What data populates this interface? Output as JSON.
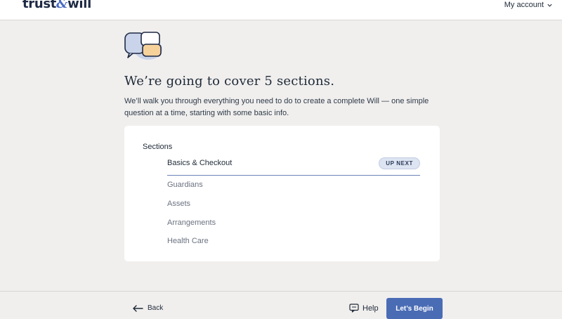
{
  "header": {
    "logo_left": "trust",
    "logo_amp": "&",
    "logo_right": "will",
    "account_label": "My account"
  },
  "main": {
    "title": "We’re going to cover 5 sections.",
    "subtitle": "We’ll walk you through everything you need to do to create a complete Will — one simple question at a time, starting with some basic info."
  },
  "sections": {
    "label": "Sections",
    "badge": "UP NEXT",
    "items": [
      {
        "label": "Basics & Checkout",
        "active": true
      },
      {
        "label": "Guardians",
        "active": false
      },
      {
        "label": "Assets",
        "active": false
      },
      {
        "label": "Arrangements",
        "active": false
      },
      {
        "label": "Health Care",
        "active": false
      }
    ]
  },
  "footer": {
    "back_label": "Back",
    "help_label": "Help",
    "begin_label": "Let’s Begin"
  },
  "colors": {
    "accent": "#4a6cb5",
    "background": "#f0efee",
    "badge_bg": "#dde4f2",
    "bubble_fill": "#f6d19a"
  },
  "icons": [
    "chat-bubbles-icon",
    "chevron-down-icon",
    "arrow-left-icon",
    "help-chat-icon"
  ]
}
